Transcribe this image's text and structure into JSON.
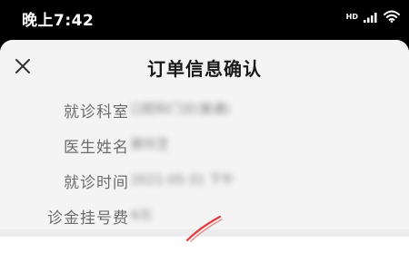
{
  "status_bar": {
    "time": "晚上7:42",
    "hd_label": "HD",
    "icons": [
      "signal-icon",
      "wifi-icon"
    ]
  },
  "dialog": {
    "title": "订单信息确认",
    "close_icon": "close-icon"
  },
  "order_info": [
    {
      "label": "就诊科室",
      "value": "口腔科门诊(普通)"
    },
    {
      "label": "医生姓名",
      "value": "蔡玲芝"
    },
    {
      "label": "就诊时间",
      "value": "2021-05-31 下午"
    },
    {
      "label": "诊金挂号费",
      "value": "6元"
    }
  ],
  "colors": {
    "status_bar_bg": "#000000",
    "sheet_bg": "#f4f4f5",
    "label_color": "#6b6b6b",
    "title_color": "#1a1a1a",
    "pen_mark": "#e2393a"
  }
}
